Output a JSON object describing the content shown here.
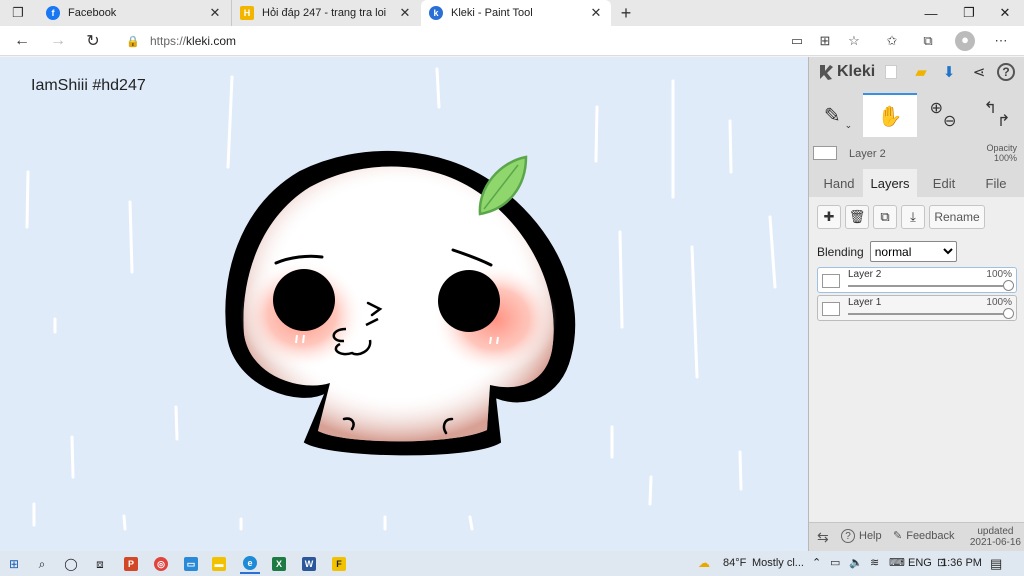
{
  "browser": {
    "tabs": [
      {
        "title": "Facebook",
        "favicon": "facebook-icon",
        "color": "#1877f2"
      },
      {
        "title": "Hỏi đáp 247 - trang tra loi",
        "favicon": "hoidap-icon",
        "color": "#f2b500"
      },
      {
        "title": "Kleki - Paint Tool",
        "favicon": "kleki-icon",
        "color": "#2a6fd6",
        "active": true
      }
    ],
    "url_scheme": "https://",
    "url_host": "kleki.com"
  },
  "canvas": {
    "label": "IamShiii #hd247",
    "background": "#e0ebfa"
  },
  "panel": {
    "brand": "Kleki",
    "current_layer": "Layer 2",
    "opacity_label": "Opacity",
    "opacity_value": "100%",
    "tabs": [
      "Hand",
      "Layers",
      "Edit",
      "File"
    ],
    "active_tab": "Layers",
    "rename_label": "Rename",
    "blending_label": "Blending",
    "blending_value": "normal",
    "layers": [
      {
        "name": "Layer 2",
        "opacity": "100%",
        "selected": true
      },
      {
        "name": "Layer 1",
        "opacity": "100%",
        "selected": false
      }
    ],
    "help_label": "Help",
    "feedback_label": "Feedback",
    "updated_label": "updated",
    "updated_date": "2021-06-16"
  },
  "taskbar": {
    "weather_temp": "84°F",
    "weather_text": "Mostly cl...",
    "language": "ENG",
    "time": "1:36 PM"
  }
}
